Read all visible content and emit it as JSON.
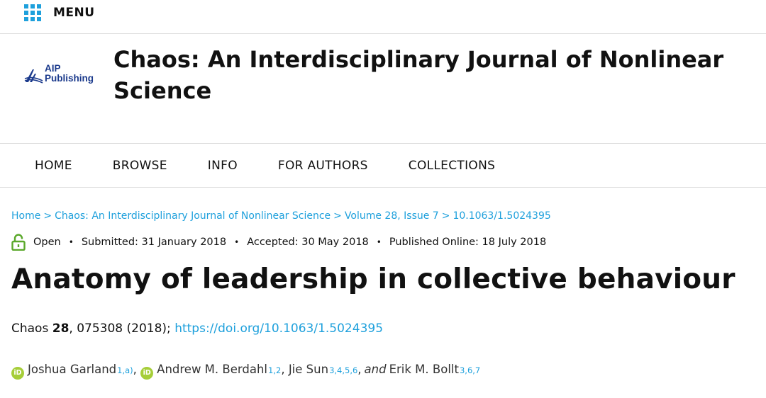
{
  "menu": {
    "label": "MENU",
    "icon": "grid-menu-icon",
    "accent": "#1ea0dc"
  },
  "publisher": {
    "logo_line1": "AIP",
    "logo_line2": "Publishing"
  },
  "journal": {
    "title": "Chaos: An Interdisciplinary Journal of Nonlinear Science"
  },
  "nav": {
    "items": [
      {
        "label": "HOME"
      },
      {
        "label": "BROWSE"
      },
      {
        "label": "INFO"
      },
      {
        "label": "FOR AUTHORS"
      },
      {
        "label": "COLLECTIONS"
      }
    ]
  },
  "breadcrumb": {
    "items": [
      {
        "label": "Home"
      },
      {
        "label": "Chaos: An Interdisciplinary Journal of Nonlinear Science"
      },
      {
        "label": "Volume 28, Issue 7"
      },
      {
        "label": "10.1063/1.5024395"
      }
    ],
    "separator": ">"
  },
  "status": {
    "access": "Open",
    "submitted": "Submitted: 31 January 2018",
    "accepted": "Accepted: 30 May 2018",
    "published": "Published Online: 18 July 2018",
    "bullet": "•",
    "access_color": "#5aa82a"
  },
  "article": {
    "title": "Anatomy of leadership in collective behaviour"
  },
  "citation": {
    "journal": "Chaos",
    "volume": "28",
    "rest": ", 075308 (2018);",
    "doi_url": "https://doi.org/10.1063/1.5024395"
  },
  "authors": {
    "list": [
      {
        "name": "Joshua Garland",
        "aff": "1,a)",
        "orcid": true
      },
      {
        "name": "Andrew M. Berdahl",
        "aff": "1,2",
        "orcid": true
      },
      {
        "name": "Jie Sun",
        "aff": "3,4,5,6",
        "orcid": false
      },
      {
        "name": "Erik M. Bollt",
        "aff": "3,6,7",
        "orcid": false
      }
    ],
    "comma": ",",
    "and": "and",
    "orcid_badge": "iD",
    "orcid_color": "#a6ce39"
  }
}
